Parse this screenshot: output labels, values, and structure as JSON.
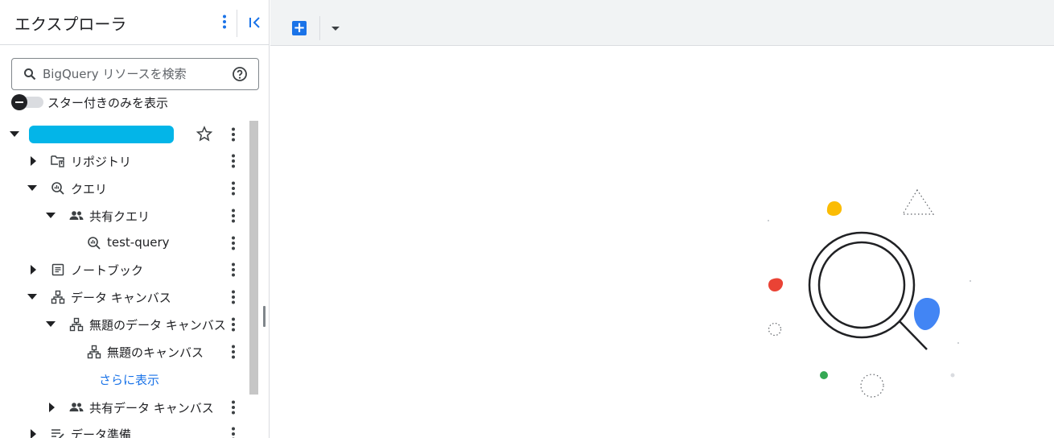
{
  "sidebar": {
    "title": "エクスプローラ",
    "search": {
      "placeholder": "BigQuery リソースを検索",
      "value": ""
    },
    "toggle": {
      "label": "スター付きのみを表示",
      "on": false
    },
    "tree": [
      {
        "label": "",
        "kind": "project",
        "expanded": true
      },
      {
        "label": "リポジトリ",
        "icon": "repository-icon",
        "expanded": false
      },
      {
        "label": "クエリ",
        "icon": "query-icon",
        "expanded": true
      },
      {
        "label": "共有クエリ",
        "icon": "people-icon",
        "expanded": true
      },
      {
        "label": "test-query",
        "icon": "query-icon"
      },
      {
        "label": "ノートブック",
        "icon": "notebook-icon",
        "expanded": false
      },
      {
        "label": "データ キャンバス",
        "icon": "canvas-icon",
        "expanded": true
      },
      {
        "label": "無題のデータ キャンバス",
        "icon": "canvas-icon",
        "expanded": true
      },
      {
        "label": "無題のキャンバス",
        "icon": "canvas-icon"
      },
      {
        "label": "さらに表示",
        "kind": "link"
      },
      {
        "label": "共有データ キャンバス",
        "icon": "people-icon",
        "expanded": false
      },
      {
        "label": "データ準備",
        "icon": "data-prep-icon",
        "expanded": false
      }
    ]
  },
  "toolbar": {
    "new_tab_icon": "add-box-icon",
    "dropdown_icon": "arrow-drop-down-icon"
  },
  "colors": {
    "accent": "#1a73e8",
    "project_pill": "#03b5e8",
    "yellow": "#fbbc04",
    "red": "#ea4335",
    "blue": "#4285f4",
    "green": "#34a853"
  }
}
